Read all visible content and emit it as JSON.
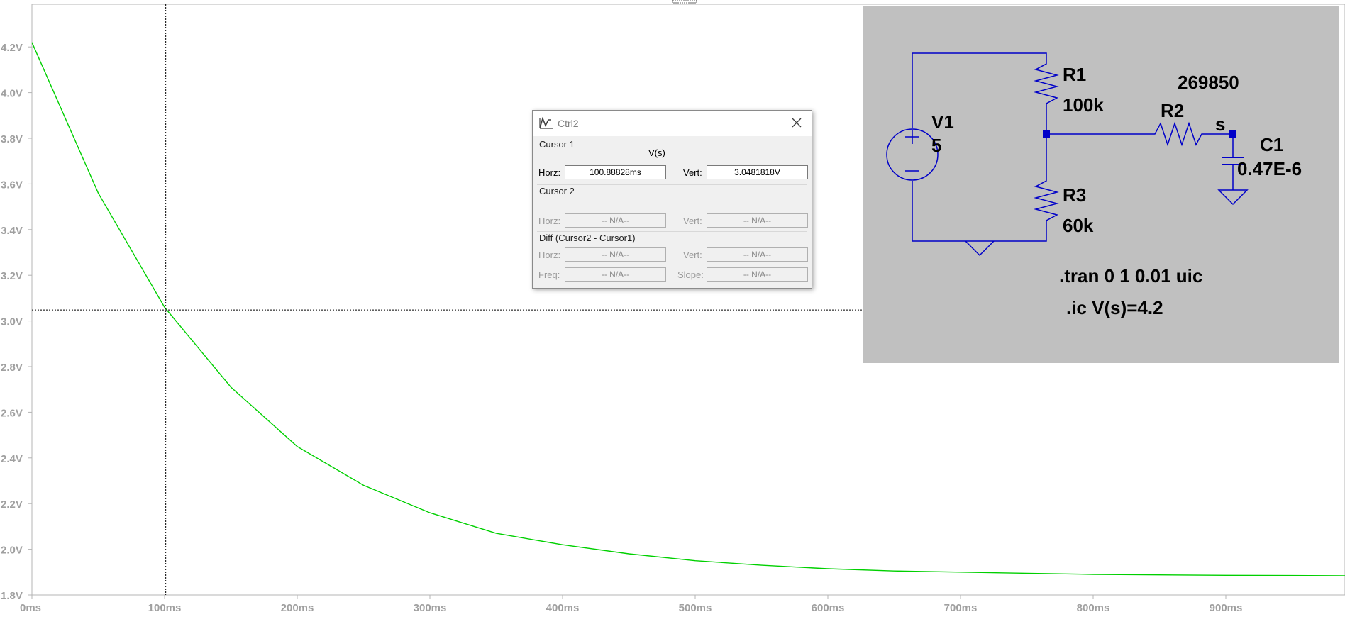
{
  "plot": {
    "y_ticks": [
      "4.2V",
      "4.0V",
      "3.8V",
      "3.6V",
      "3.4V",
      "3.2V",
      "3.0V",
      "2.8V",
      "2.6V",
      "2.4V",
      "2.2V",
      "2.0V",
      "1.8V"
    ],
    "x_ticks": [
      "0ms",
      "100ms",
      "200ms",
      "300ms",
      "400ms",
      "500ms",
      "600ms",
      "700ms",
      "800ms",
      "900ms"
    ],
    "trace_color": "#00d000",
    "cursor": {
      "time_ms": 100.88828,
      "voltage": 3.0481818
    }
  },
  "chart_data": {
    "type": "line",
    "xlabel": "",
    "ylabel": "",
    "xlim": [
      0,
      1000
    ],
    "ylim": [
      1.8,
      4.25
    ],
    "x_unit": "ms",
    "y_unit": "V",
    "series": [
      {
        "name": "",
        "x": [
          0,
          50,
          100,
          150,
          200,
          250,
          300,
          350,
          400,
          450,
          500,
          550,
          600,
          650,
          700,
          750,
          800,
          850,
          900,
          950,
          1000
        ],
        "y": [
          4.22,
          3.56,
          3.06,
          2.71,
          2.45,
          2.28,
          2.16,
          2.07,
          2.02,
          1.98,
          1.95,
          1.93,
          1.915,
          1.905,
          1.9,
          1.895,
          1.89,
          1.888,
          1.886,
          1.885,
          1.884
        ]
      }
    ]
  },
  "schematic": {
    "v1_name": "V1",
    "v1_value": "5",
    "r1_name": "R1",
    "r1_value": "100k",
    "r2_name": "R2",
    "r2_value": "269850",
    "r3_name": "R3",
    "r3_value": "60k",
    "c1_name": "C1",
    "c1_value": "0.47E-6",
    "node_label": "s",
    "directive_tran": ".tran 0 1 0.01 uic",
    "directive_ic": ".ic V(s)=4.2",
    "bg_color": "#c0c0c0",
    "wire_color": "#0000c8"
  },
  "ctrl_dialog": {
    "title": "Ctrl2",
    "cursor1_label": "Cursor 1",
    "trace_name": "V(s)",
    "cursor2_label": "Cursor 2",
    "diff_label": "Diff (Cursor2 - Cursor1)",
    "horz_label": "Horz:",
    "vert_label": "Vert:",
    "freq_label": "Freq:",
    "slope_label": "Slope:",
    "c1_horz": "100.88828ms",
    "c1_vert": "3.0481818V",
    "na": "-- N/A--"
  }
}
